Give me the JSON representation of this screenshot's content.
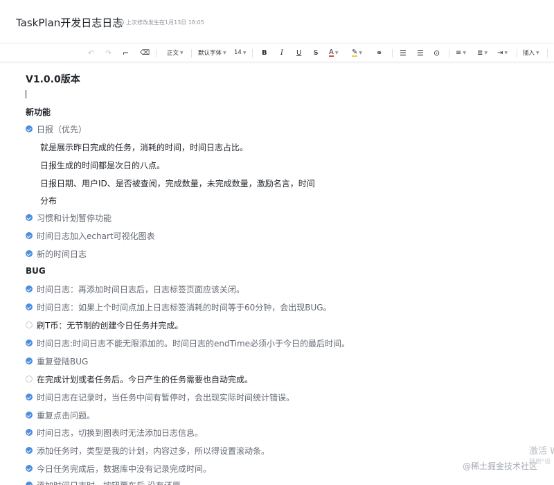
{
  "header": {
    "title": "TaskPlan开发日志日志",
    "last_modified": "上次修改发生在1月13日 18:05"
  },
  "toolbar": {
    "paragraph_style": "正文",
    "font_family": "默认字体",
    "font_size": "14",
    "bold": "B",
    "italic": "I",
    "underline": "U",
    "strike": "S",
    "font_color": "A",
    "insert": "插入"
  },
  "doc": {
    "version_heading": "V1.0.0版本",
    "new_features_heading": "新功能",
    "bug_heading": "BUG",
    "features": [
      {
        "text": "日报（优先）",
        "checked": true
      },
      {
        "text": "习惯和计划暂停功能",
        "checked": true
      },
      {
        "text": "时间日志加入echart可视化图表",
        "checked": true
      },
      {
        "text": "新的时间日志",
        "checked": true
      }
    ],
    "daily_report_paragraphs": [
      "就是展示昨日完成的任务，消耗的时间，时间日志占比。",
      "日报生成的时间都是次日的八点。",
      "日报日期、用户ID、是否被查阅，完成数量，未完成数量，激励名言，时间",
      "分布"
    ],
    "bugs": [
      {
        "text": "时间日志：再添加时间日志后，日志标签页面应该关闭。",
        "checked": true
      },
      {
        "text": "时间日志：如果上个时间点加上日志标签消耗的时间等于60分钟，会出现BUG。",
        "checked": true
      },
      {
        "text": "刷T币：无节制的创建今日任务并完成。",
        "checked": false
      },
      {
        "text": "时间日志:时间日志不能无限添加的。时间日志的endTime必须小于今日的最后时间。",
        "checked": true
      },
      {
        "text": "重复登陆BUG",
        "checked": true
      },
      {
        "text": "在完成计划或者任务后。今日产生的任务需要也自动完成。",
        "checked": false
      },
      {
        "text": "时间日志在记录时，当任务中间有暂停时，会出现实际时间统计错误。",
        "checked": true
      },
      {
        "text": "重复点击问题。",
        "checked": true
      },
      {
        "text": "时间日志，切换到图表时无法添加日志信息。",
        "checked": true
      },
      {
        "text": "添加任务时，类型是我的计划，内容过多，所以得设置滚动条。",
        "checked": true
      },
      {
        "text": "今日任务完成后，数据库中没有记录完成时间。",
        "checked": true
      },
      {
        "text": "添加时间日志时，按钮覆车后 没有还原",
        "checked": true
      }
    ]
  },
  "overlay": {
    "watermark": "@稀土掘金技术社区",
    "activate": "激活 W",
    "activate_sub": "转到\"设"
  }
}
